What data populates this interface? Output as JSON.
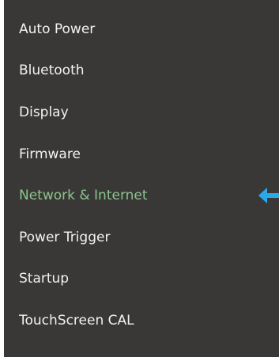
{
  "menu": {
    "items": [
      {
        "label": "Auto Power"
      },
      {
        "label": "Bluetooth"
      },
      {
        "label": "Display"
      },
      {
        "label": "Firmware"
      },
      {
        "label": "Network & Internet",
        "active": true
      },
      {
        "label": "Power Trigger"
      },
      {
        "label": "Startup"
      },
      {
        "label": "TouchScreen CAL"
      }
    ],
    "selected_index": 4,
    "selection_indicator_icon": "arrow-left-icon"
  },
  "colors": {
    "panel_background": "#3a3836",
    "text": "#f2f2f2",
    "active_text": "#8bc48e",
    "indicator_arrow": "#2aa9e8"
  }
}
